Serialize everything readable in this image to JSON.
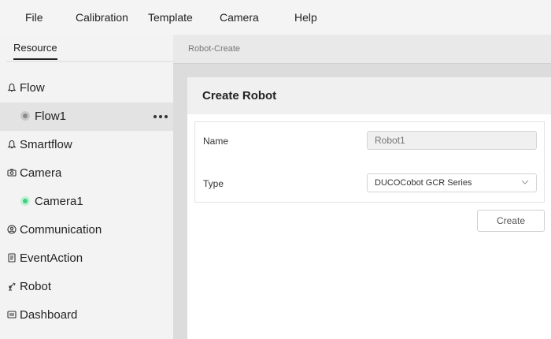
{
  "menu": {
    "items": [
      {
        "label": "File"
      },
      {
        "label": "Calibration"
      },
      {
        "label": "Template"
      },
      {
        "label": "Camera"
      },
      {
        "label": "Help"
      }
    ]
  },
  "sidebar": {
    "tab_label": "Resource",
    "items": [
      {
        "label": "Flow",
        "icon": "bell-icon"
      },
      {
        "label": "Flow1",
        "icon": "status-dot-gray",
        "selected": true
      },
      {
        "label": "Smartflow",
        "icon": "bell-icon"
      },
      {
        "label": "Camera",
        "icon": "camera-icon"
      },
      {
        "label": "Camera1",
        "icon": "status-dot-green"
      },
      {
        "label": "Communication",
        "icon": "communication-icon"
      },
      {
        "label": "EventAction",
        "icon": "document-icon"
      },
      {
        "label": "Robot",
        "icon": "robot-arm-icon"
      },
      {
        "label": "Dashboard",
        "icon": "dashboard-icon"
      }
    ]
  },
  "main": {
    "breadcrumb": "Robot-Create",
    "panel_title": "Create Robot",
    "form": {
      "name_label": "Name",
      "name_placeholder": "Robot1",
      "type_label": "Type",
      "type_value": "DUCOCobot GCR Series"
    },
    "create_label": "Create"
  },
  "colors": {
    "menubar_bg": "#f4f4f4",
    "sidebar_bg": "#f3f3f3",
    "selected_bg": "#e3e3e3",
    "status_gray": "#8a8a8a",
    "status_green": "#3fcf7f",
    "main_bg": "#dcdcdc"
  }
}
